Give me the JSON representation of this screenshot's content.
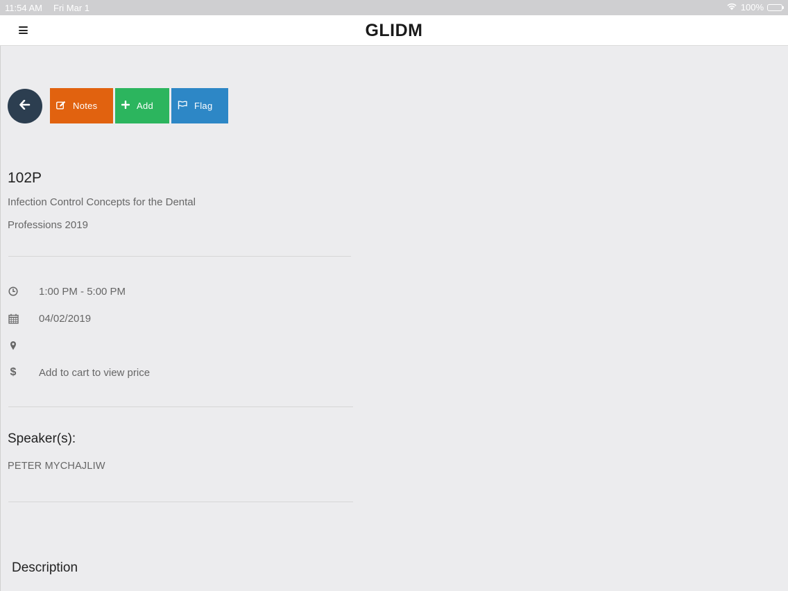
{
  "status_bar": {
    "time": "11:54 AM",
    "date": "Fri Mar 1",
    "battery": "100%"
  },
  "nav": {
    "title": "GLIDM"
  },
  "actions": {
    "notes": "Notes",
    "add": "Add",
    "flag": "Flag"
  },
  "course": {
    "code": "102P",
    "title": "Infection Control Concepts for the Dental Professions 2019"
  },
  "details": {
    "time": "1:00 PM - 5:00 PM",
    "date": "04/02/2019",
    "location": "",
    "price": "Add to cart to view price"
  },
  "speakers": {
    "heading": "Speaker(s):",
    "names": [
      "PETER MYCHAJLIW"
    ]
  },
  "description": {
    "heading": "Description"
  },
  "colors": {
    "notes_button": "#e1620f",
    "add_button": "#2cb55e",
    "flag_button": "#2d87c6",
    "back_button": "#2c3e50",
    "background": "#ececee"
  },
  "icons": {
    "menu": "hamburger-icon",
    "back": "arrow-left-icon",
    "notes": "edit-icon",
    "add": "plus-icon",
    "flag": "flag-icon",
    "time": "clock-icon",
    "date": "calendar-icon",
    "location": "map-marker-icon",
    "price": "dollar-icon",
    "wifi": "wifi-icon",
    "battery": "battery-icon"
  }
}
